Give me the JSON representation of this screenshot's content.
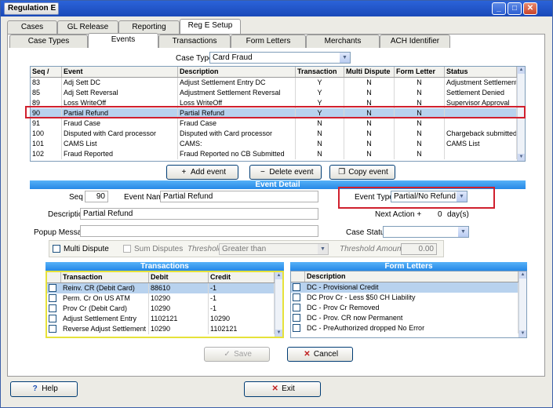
{
  "window": {
    "title": "Regulation E"
  },
  "main_tabs": [
    "Cases",
    "GL Release",
    "Reporting",
    "Reg E Setup"
  ],
  "sub_tabs": [
    "Case Types",
    "Events",
    "Transactions",
    "Form Letters",
    "Merchants",
    "ACH Identifier"
  ],
  "case_type": {
    "label": "Case Type",
    "value": "Card Fraud"
  },
  "events_grid": {
    "columns": [
      "Seq",
      "Event",
      "Description",
      "Transaction",
      "Multi Dispute",
      "Form Letter",
      "Status"
    ],
    "rows": [
      [
        "83",
        "Adj Sett DC",
        "Adjust Settlement Entry DC",
        "Y",
        "N",
        "N",
        "Adjustment Settlement"
      ],
      [
        "85",
        "Adj Sett Reversal",
        "Adjustment Settlement Reversal",
        "Y",
        "N",
        "N",
        "Settlement Denied"
      ],
      [
        "89",
        "Loss WriteOff",
        "Loss WriteOff",
        "Y",
        "N",
        "N",
        "Supervisor Approval"
      ],
      [
        "90",
        "Partial Refund",
        "Partial Refund",
        "Y",
        "N",
        "N",
        ""
      ],
      [
        "91",
        "Fraud Case",
        "Fraud Case",
        "N",
        "N",
        "N",
        ""
      ],
      [
        "100",
        "Disputed with Card processor",
        "Disputed with Card processor",
        "N",
        "N",
        "N",
        "Chargeback submitted"
      ],
      [
        "101",
        "CAMS List",
        "CAMS:",
        "N",
        "N",
        "N",
        "CAMS List"
      ],
      [
        "102",
        "Fraud Reported",
        "Fraud Reported no CB Submitted",
        "N",
        "N",
        "N",
        ""
      ]
    ],
    "selected_index": 3
  },
  "event_buttons": {
    "add": "Add event",
    "delete": "Delete event",
    "copy": "Copy event"
  },
  "detail": {
    "title": "Event Detail",
    "seq_label": "Seq",
    "seq_value": "90",
    "event_name_label": "Event Name",
    "event_name_value": "Partial Refund",
    "description_label": "Description",
    "description_value": "Partial Refund",
    "popup_label": "Popup Message",
    "popup_value": "",
    "event_type_label": "Event Type",
    "event_type_value": "Partial/No Refund",
    "next_action_label": "Next Action +",
    "next_action_value": "0",
    "next_action_unit": "day(s)",
    "case_status_label": "Case Status",
    "case_status_value": "",
    "multi_dispute_label": "Multi Dispute",
    "sum_disputes_label": "Sum Disputes",
    "threshold_label": "Threshold",
    "threshold_value": "Greater than",
    "threshold_amount_label": "Threshold Amount",
    "threshold_amount_value": "0.00"
  },
  "transactions": {
    "title": "Transactions",
    "columns": [
      "Transaction",
      "Debit",
      "Credit"
    ],
    "rows": [
      [
        "Reinv. CR (Debit Card)",
        "88610",
        "-1"
      ],
      [
        "Perm. Cr On US ATM",
        "10290",
        "-1"
      ],
      [
        "Prov Cr (Debit Card)",
        "10290",
        "-1"
      ],
      [
        "Adjust Settlement Entry",
        "1102121",
        "10290"
      ],
      [
        "Reverse Adjust Settlement",
        "10290",
        "1102121"
      ]
    ]
  },
  "form_letters": {
    "title": "Form Letters",
    "columns": [
      "Description"
    ],
    "rows": [
      "DC - Provisional Credit",
      "DC Prov Cr - Less $50 CH Liability",
      "DC - Prov Cr Removed",
      "DC - Prov. CR now Permanent",
      "DC - PreAuthorized dropped No Error"
    ]
  },
  "actions": {
    "save": "Save",
    "cancel": "Cancel",
    "help": "Help",
    "exit": "Exit"
  }
}
